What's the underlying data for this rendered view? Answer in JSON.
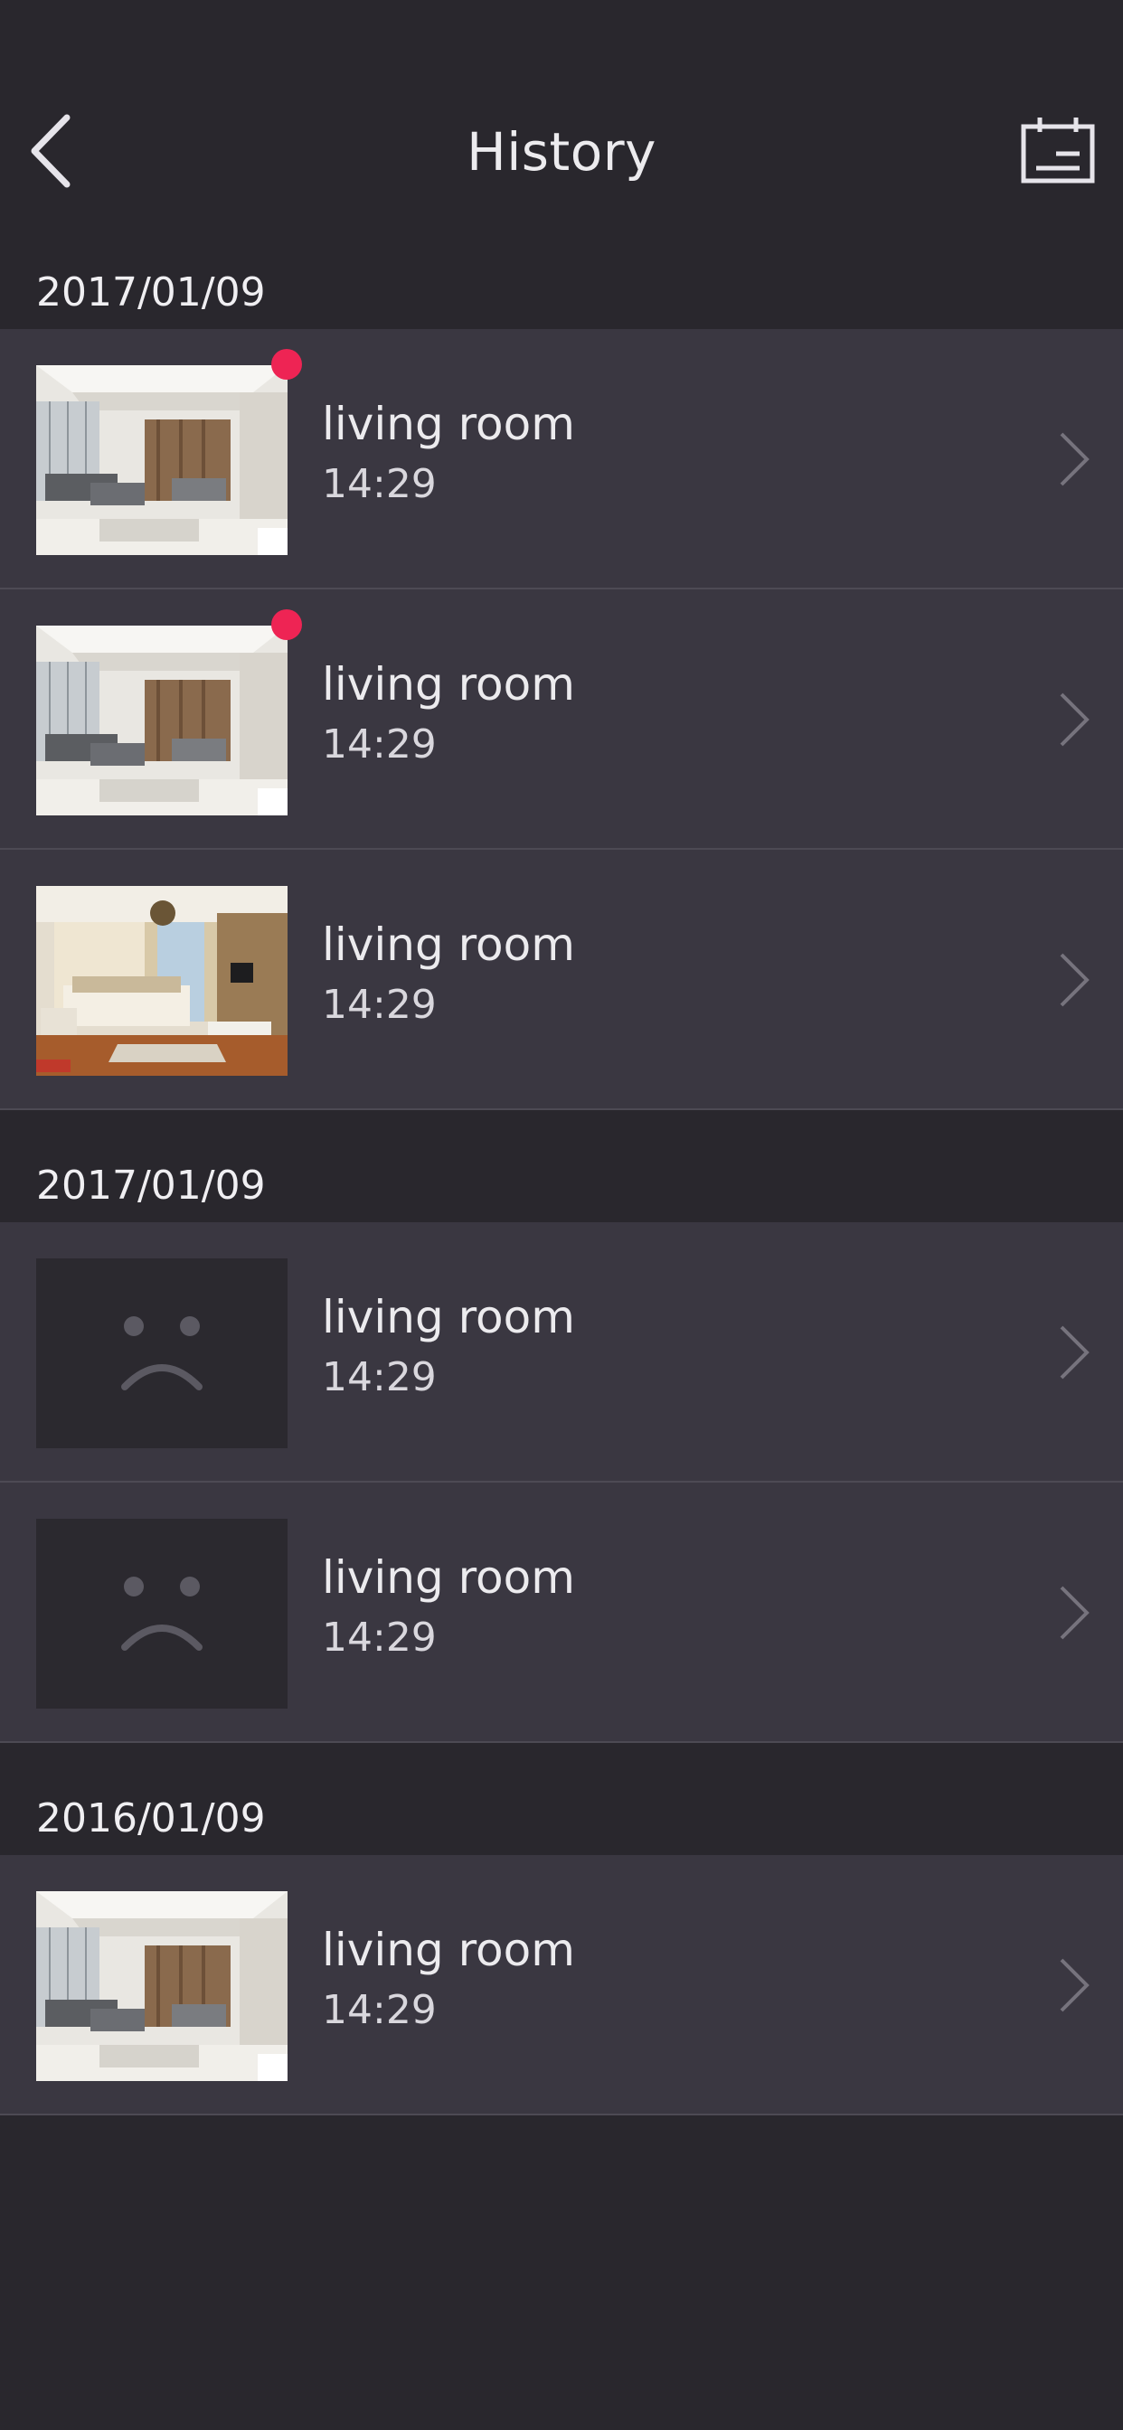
{
  "header": {
    "title": "History",
    "back_icon": "chevron-left-icon",
    "calendar_icon": "calendar-icon"
  },
  "colors": {
    "background": "#29272d",
    "row": "#3a3741",
    "unread_dot": "#ee2454"
  },
  "sections": [
    {
      "date": "2017/01/09",
      "items": [
        {
          "title": "living room",
          "time": "14:29",
          "thumbnail": "living-room-photo",
          "unread": true
        },
        {
          "title": "living room",
          "time": "14:29",
          "thumbnail": "living-room-photo",
          "unread": true
        },
        {
          "title": "living room",
          "time": "14:29",
          "thumbnail": "bedroom-photo",
          "unread": false
        }
      ]
    },
    {
      "date": "2017/01/09",
      "items": [
        {
          "title": "living room",
          "time": "14:29",
          "thumbnail": "sad-face-icon",
          "unread": false
        },
        {
          "title": "living room",
          "time": "14:29",
          "thumbnail": "sad-face-icon",
          "unread": false
        }
      ]
    },
    {
      "date": "2016/01/09",
      "items": [
        {
          "title": "living room",
          "time": "14:29",
          "thumbnail": "living-room-photo",
          "unread": false
        }
      ]
    }
  ]
}
